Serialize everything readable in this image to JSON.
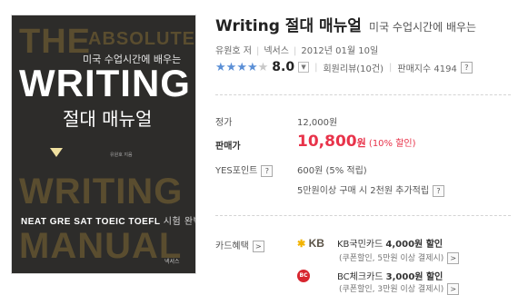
{
  "cover": {
    "the": "THE",
    "absolute": "ABSOLUTE",
    "subtitle_kr": "미국 수업시간에 배우는",
    "writing": "WRITING",
    "manual_kr": "절대 매뉴얼",
    "author_small": "유원호 지음",
    "writing_outline": "WRITING",
    "tests": "NEAT GRE SAT TOEIC TOEFL",
    "tests_kr": "시험 완벽 대비",
    "manual": "MANUAL",
    "publisher_small": "넥서스"
  },
  "book": {
    "title": "Writing 절대 매뉴얼",
    "subtitle": "미국 수업시간에 배우는",
    "author": "유원호 저",
    "publisher": "넥서스",
    "date": "2012년 01월 10일"
  },
  "rating": {
    "stars": 4,
    "score": "8.0",
    "reviews": "회원리뷰(10건)",
    "sales_index": "판매지수 4194",
    "dropdown_icon": "chevron-down-icon",
    "question_icon": "question-icon"
  },
  "price": {
    "list_label": "정가",
    "list_price": "12,000원",
    "sale_label": "판매가",
    "sale_price": "10,800",
    "sale_unit": "원",
    "discount": "(10% 할인)",
    "points_label": "YES포인트",
    "points_value": "600원 (5% 적립)",
    "points_extra": "5만원이상 구매 시 2천원 추가적립",
    "help_glyph": "?"
  },
  "cards": {
    "label": "카드혜택",
    "more_glyph": ">",
    "items": [
      {
        "logo": "KB",
        "name_prefix": "KB국민카드",
        "amount": "4,000원 할인",
        "note": "(쿠폰할인, 5만원 이상 결제시)"
      },
      {
        "logo": "BC",
        "name_prefix": "BC체크카드",
        "amount": "3,000원 할인",
        "note": "(쿠폰할인, 3만원 이상 결제시)"
      }
    ]
  },
  "colors": {
    "sale": "#e8334a",
    "star": "#5b8fd6",
    "cover_bg": "#2d2c2a"
  }
}
